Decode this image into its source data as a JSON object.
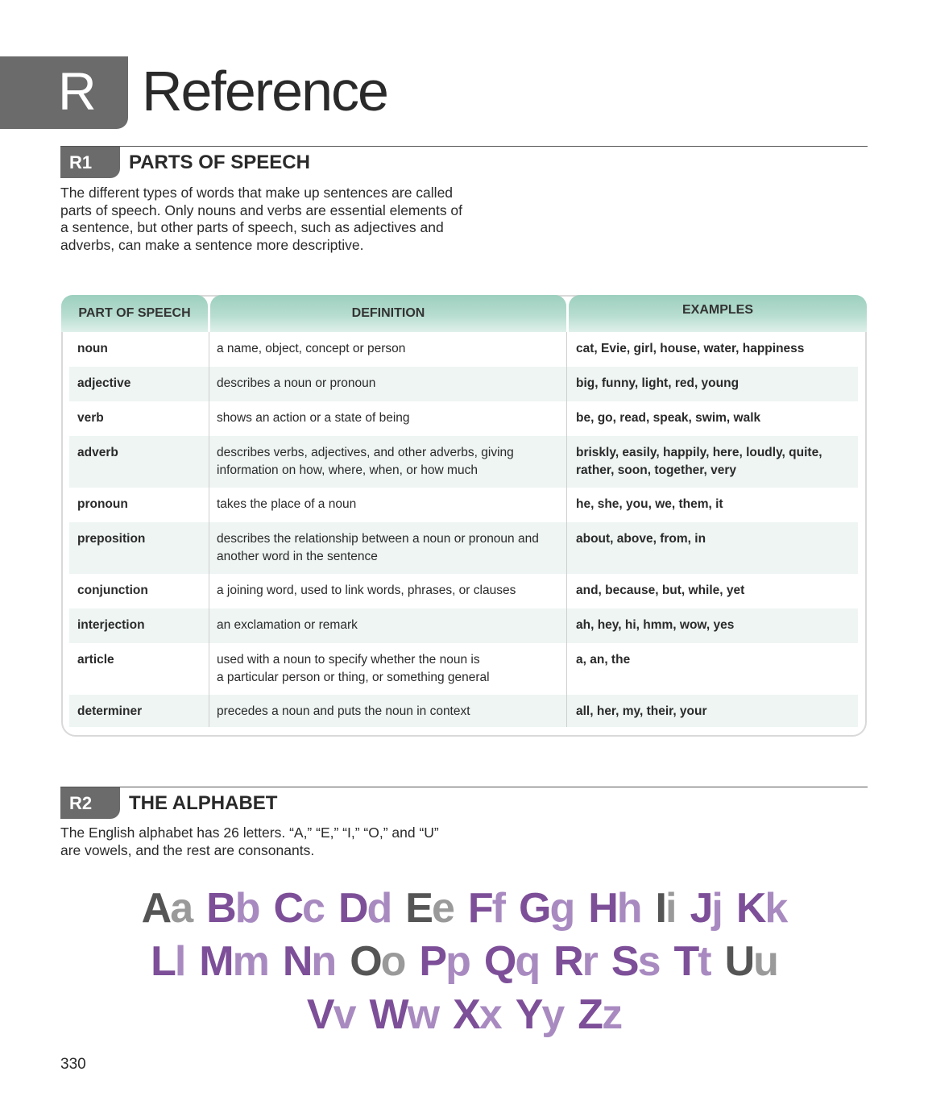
{
  "chapter": {
    "letter": "R",
    "title": "Reference"
  },
  "r1": {
    "tag": "R1",
    "title": "PARTS OF SPEECH",
    "intro_lines": [
      "The different types of words that make up sentences are called",
      "parts of speech. Only nouns and verbs are essential elements of",
      "a sentence, but other parts of speech, such as adjectives and",
      "adverbs, can make a sentence more descriptive."
    ]
  },
  "table": {
    "headers": [
      "PART OF SPEECH",
      "DEFINITION",
      "EXAMPLES"
    ],
    "header_color": "#a9d6c6",
    "row_shade_color": "#eef5f3",
    "rows": [
      {
        "part": "noun",
        "definition": [
          "a name, object, concept or person"
        ],
        "examples": [
          "cat, Evie, girl, house, water, happiness"
        ]
      },
      {
        "part": "adjective",
        "definition": [
          "describes a noun or pronoun"
        ],
        "examples": [
          "big, funny, light, red, young"
        ]
      },
      {
        "part": "verb",
        "definition": [
          "shows an action or a state of being"
        ],
        "examples": [
          "be, go, read, speak, swim, walk"
        ]
      },
      {
        "part": "adverb",
        "definition": [
          "describes verbs, adjectives, and other adverbs, giving",
          "information on how, where, when, or how much"
        ],
        "examples": [
          "briskly, easily, happily, here, loudly, quite,",
          "rather, soon, together, very"
        ]
      },
      {
        "part": "pronoun",
        "definition": [
          "takes the place of a noun"
        ],
        "examples": [
          "he, she, you, we, them, it"
        ]
      },
      {
        "part": "preposition",
        "definition": [
          "describes the relationship between a noun or pronoun and",
          "another word in the sentence"
        ],
        "examples": [
          "about, above, from, in"
        ]
      },
      {
        "part": "conjunction",
        "definition": [
          "a joining word, used to link words, phrases, or clauses"
        ],
        "examples": [
          "and, because, but, while, yet"
        ]
      },
      {
        "part": "interjection",
        "definition": [
          "an exclamation or remark"
        ],
        "examples": [
          "ah, hey, hi, hmm, wow, yes"
        ]
      },
      {
        "part": "article",
        "definition": [
          "used with a noun to specify whether the noun is",
          "a particular person or thing, or something general"
        ],
        "examples": [
          "a, an, the"
        ]
      },
      {
        "part": "determiner",
        "definition": [
          "precedes a noun and puts the noun in context"
        ],
        "examples": [
          "all, her, my, their, your"
        ]
      }
    ]
  },
  "r2": {
    "tag": "R2",
    "title": "THE ALPHABET",
    "intro_lines": [
      "The English alphabet has 26 letters. “A,” “E,” “I,” “O,” and “U”",
      "are vowels, and the rest are consonants."
    ]
  },
  "alphabet": {
    "consonant_color": "#7d4f98",
    "vowel_color": "#555555",
    "lines": [
      [
        [
          "A",
          "a",
          true
        ],
        [
          "B",
          "b",
          false
        ],
        [
          "C",
          "c",
          false
        ],
        [
          "D",
          "d",
          false
        ],
        [
          "E",
          "e",
          true
        ],
        [
          "F",
          "f",
          false
        ],
        [
          "G",
          "g",
          false
        ],
        [
          "H",
          "h",
          false
        ],
        [
          "I",
          "i",
          true
        ],
        [
          "J",
          "j",
          false
        ],
        [
          "K",
          "k",
          false
        ]
      ],
      [
        [
          "L",
          "l",
          false
        ],
        [
          "M",
          "m",
          false
        ],
        [
          "N",
          "n",
          false
        ],
        [
          "O",
          "o",
          true
        ],
        [
          "P",
          "p",
          false
        ],
        [
          "Q",
          "q",
          false
        ],
        [
          "R",
          "r",
          false
        ],
        [
          "S",
          "s",
          false
        ],
        [
          "T",
          "t",
          false
        ],
        [
          "U",
          "u",
          true
        ]
      ],
      [
        [
          "V",
          "v",
          false
        ],
        [
          "W",
          "w",
          false
        ],
        [
          "X",
          "x",
          false
        ],
        [
          "Y",
          "y",
          false
        ],
        [
          "Z",
          "z",
          false
        ]
      ]
    ]
  },
  "page_number": "330"
}
